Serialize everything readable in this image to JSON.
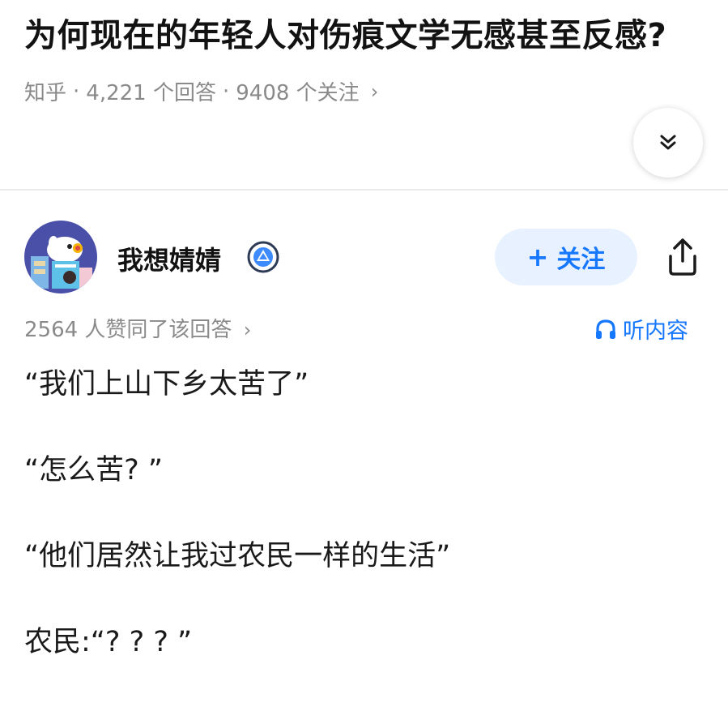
{
  "question": {
    "title": "为何现在的年轻人对伤痕文学无感甚至反感?",
    "source": "知乎",
    "separator": "·",
    "answers": "4,221 个回答",
    "followers": "9408 个关注",
    "chevron": "›"
  },
  "icons": {
    "expand": "chevron-double-down-icon",
    "verified": "verified-badge-icon",
    "share": "share-icon",
    "headphones": "headphones-icon"
  },
  "author": {
    "name": "我想婧婧",
    "follow_plus": "+",
    "follow_label": "关注"
  },
  "answer": {
    "votes": "2564 人赞同了该回答",
    "chevron": "›",
    "listen_label": "听内容",
    "paragraphs": [
      "“我们上山下乡太苦了”",
      "“怎么苦? ”",
      "“他们居然让我过农民一样的生活”",
      "农民:“? ? ? ”"
    ]
  },
  "colors": {
    "accent": "#1677ff",
    "follow_bg": "#e8f1ff",
    "meta_text": "#8a8a8a",
    "title_text": "#121212"
  }
}
